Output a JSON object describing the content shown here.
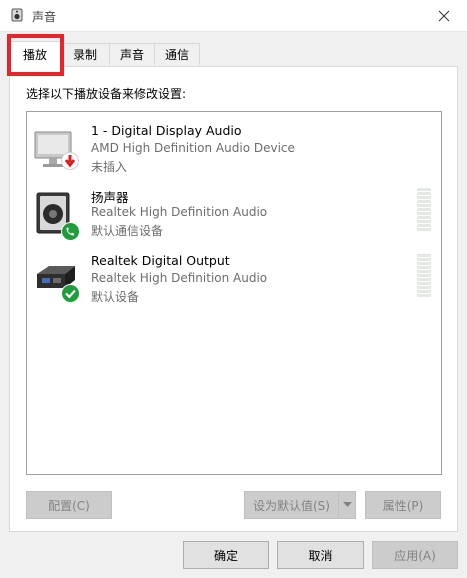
{
  "window": {
    "title": "声音",
    "icon": "speaker-icon",
    "close_icon": "close-icon"
  },
  "tabs": [
    {
      "label": "播放",
      "active": true
    },
    {
      "label": "录制",
      "active": false
    },
    {
      "label": "声音",
      "active": false
    },
    {
      "label": "通信",
      "active": false
    }
  ],
  "instruction": "选择以下播放设备来修改设置:",
  "devices": [
    {
      "name": "1 - Digital Display Audio",
      "driver": "AMD High Definition Audio Device",
      "status": "未插入",
      "icon": "monitor-icon",
      "badge": "unplugged-arrow-icon"
    },
    {
      "name": "扬声器",
      "driver": "Realtek High Definition Audio",
      "status": "默认通信设备",
      "icon": "speaker-device-icon",
      "badge": "phone-icon"
    },
    {
      "name": "Realtek Digital Output",
      "driver": "Realtek High Definition Audio",
      "status": "默认设备",
      "icon": "digital-output-icon",
      "badge": "check-icon"
    }
  ],
  "panel_buttons": {
    "configure": "配置(C)",
    "set_default": "设为默认值(S)",
    "properties": "属性(P)"
  },
  "dialog_buttons": {
    "ok": "确定",
    "cancel": "取消",
    "apply": "应用(A)"
  },
  "colors": {
    "highlight": "#e8232b",
    "badge_green": "#1f9d3a",
    "badge_red": "#d81e1e"
  }
}
